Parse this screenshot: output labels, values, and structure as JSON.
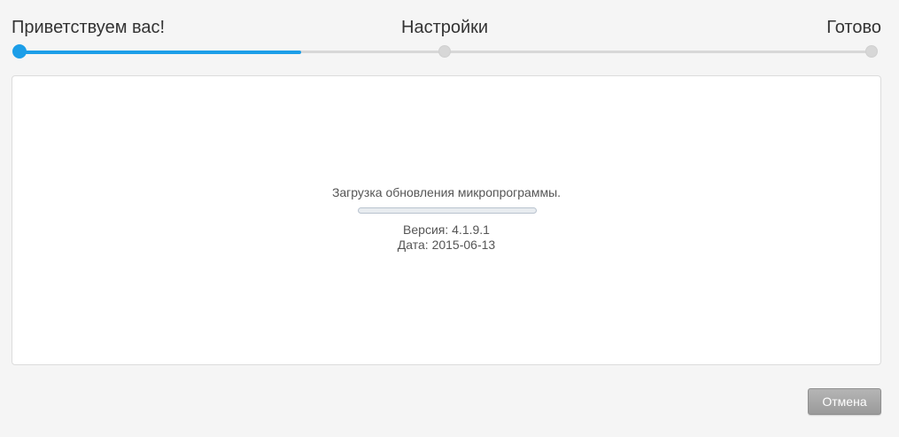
{
  "wizard": {
    "steps": [
      {
        "label": "Приветствуем вас!",
        "state": "active"
      },
      {
        "label": "Настройки",
        "state": "pending"
      },
      {
        "label": "Готово",
        "state": "pending"
      }
    ],
    "progress_fraction": 0.33
  },
  "panel": {
    "status_text": "Загрузка обновления микропрограммы.",
    "download_progress_fraction": 0,
    "version_text": "Версия: 4.1.9.1",
    "date_text": "Дата: 2015-06-13"
  },
  "footer": {
    "cancel_label": "Отмена"
  },
  "colors": {
    "accent": "#1c9ee8",
    "track": "#d7d7d7",
    "button": "#a6a6a6"
  }
}
